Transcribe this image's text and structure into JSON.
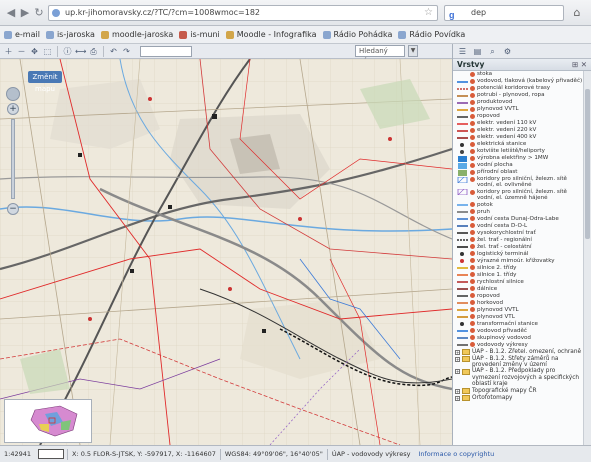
{
  "browser": {
    "url": "up.kr-jihomoravsky.cz/?TC/?cm=1008wmoc=182",
    "search_value": "dep",
    "search_engine_glyph": "g"
  },
  "bookmarks": [
    {
      "label": "e-mail",
      "fav": "b"
    },
    {
      "label": "is-jaroska",
      "fav": "b"
    },
    {
      "label": "moodle-jaroska",
      "fav": "g"
    },
    {
      "label": "is-muni",
      "fav": "r"
    },
    {
      "label": "Moodle - Infografika",
      "fav": "g"
    },
    {
      "label": "Rádio Pohádka",
      "fav": "b"
    },
    {
      "label": "Rádio Povídka",
      "fav": "b"
    }
  ],
  "toolbar": {
    "find_placeholder": "Hledaný výraz...",
    "icons": [
      "zoom-in-icon",
      "zoom-out-icon",
      "pan-icon",
      "zoom-box-icon",
      "info-icon",
      "measure-icon",
      "print-icon",
      "back-icon",
      "forward-icon"
    ]
  },
  "map": {
    "tab_label": "Změnit mapu"
  },
  "panel": {
    "title": "Vrstvy",
    "controls": "⊞ ✕"
  },
  "layers": [
    {
      "type": "layer",
      "label": "stoka",
      "sym": "none",
      "color": "#555"
    },
    {
      "type": "layer",
      "label": "vodovod, tlaková (kabelový přivaděč)",
      "sym": "line",
      "color": "#1b6fd6"
    },
    {
      "type": "layer",
      "label": "potenciál koridorové trasy",
      "sym": "dash",
      "color": "#c2423a"
    },
    {
      "type": "layer",
      "label": "potrubí - plynovod, ropa",
      "sym": "line",
      "color": "#b36b1e"
    },
    {
      "type": "layer",
      "label": "produktovod",
      "sym": "line",
      "color": "#7a3b9c"
    },
    {
      "type": "layer",
      "label": "plynovod VVTL",
      "sym": "line",
      "color": "#d48b00"
    },
    {
      "type": "layer",
      "label": "ropovod",
      "sym": "line",
      "color": "#333"
    },
    {
      "type": "layer",
      "label": "elektr. vedení 110 kV",
      "sym": "line",
      "color": "#e02b2b"
    },
    {
      "type": "layer",
      "label": "elektr. vedení 220 kV",
      "sym": "line",
      "color": "#c01d1d"
    },
    {
      "type": "layer",
      "label": "elektr. vedení 400 kV",
      "sym": "line",
      "color": "#8e1010"
    },
    {
      "type": "layer",
      "label": "elektrická stanice",
      "sym": "dot",
      "color": "#333"
    },
    {
      "type": "layer",
      "label": "kotvište letiště/heliporty",
      "sym": "dot",
      "color": "#444"
    },
    {
      "type": "layer",
      "label": "výrobna elektřiny > 1MW",
      "sym": "box",
      "color": "#2a7fd0"
    },
    {
      "type": "layer",
      "label": "vodní plocha",
      "sym": "box",
      "color": "#5aa9e6"
    },
    {
      "type": "layer",
      "label": "přírodní oblast",
      "sym": "box",
      "color": "#88b06a"
    },
    {
      "type": "layer",
      "label": "koridory pro silniční, železn. sítě vodní, el. ovlivněné",
      "sym": "hatch",
      "color": "#3d7bd8"
    },
    {
      "type": "layer",
      "label": "koridory pro silniční, železn. sítě vodní, el. územně hájené",
      "sym": "hatch",
      "color": "#8f5cc4"
    },
    {
      "type": "layer",
      "label": "potok",
      "sym": "line",
      "color": "#4c9be6"
    },
    {
      "type": "layer",
      "label": "pruh",
      "sym": "line",
      "color": "#666"
    },
    {
      "type": "layer",
      "label": "vodní cesta Dunaj-Odra-Labe",
      "sym": "line",
      "color": "#2d6fc8"
    },
    {
      "type": "layer",
      "label": "vodní cesta D-O-L",
      "sym": "line",
      "color": "#2257a6"
    },
    {
      "type": "layer",
      "label": "vysokorychlostní trať",
      "sym": "line",
      "color": "#222"
    },
    {
      "type": "layer",
      "label": "žel. trať - regionální",
      "sym": "dash",
      "color": "#333"
    },
    {
      "type": "layer",
      "label": "žel. trať - celostátní",
      "sym": "line",
      "color": "#111"
    },
    {
      "type": "layer",
      "label": "logistický terminál",
      "sym": "dot",
      "color": "#333"
    },
    {
      "type": "layer",
      "label": "výrazné mimoúr. křižovatky",
      "sym": "dot",
      "color": "#c33"
    },
    {
      "type": "layer",
      "label": "silnice 2. třídy",
      "sym": "line",
      "color": "#d9a400"
    },
    {
      "type": "layer",
      "label": "silnice 1. třídy",
      "sym": "line",
      "color": "#e25b1e"
    },
    {
      "type": "layer",
      "label": "rychlostní silnice",
      "sym": "line",
      "color": "#b32525"
    },
    {
      "type": "layer",
      "label": "dálnice",
      "sym": "line",
      "color": "#7a1616"
    },
    {
      "type": "layer",
      "label": "ropovod",
      "sym": "line",
      "color": "#333"
    },
    {
      "type": "layer",
      "label": "horkovod",
      "sym": "line",
      "color": "#d9682a"
    },
    {
      "type": "layer",
      "label": "plynovod VVTL",
      "sym": "line",
      "color": "#d48b00"
    },
    {
      "type": "layer",
      "label": "plynovod VTL",
      "sym": "line",
      "color": "#c87c00"
    },
    {
      "type": "layer",
      "label": "transformační stanice",
      "sym": "dot",
      "color": "#333"
    },
    {
      "type": "layer",
      "label": "vodovod přivaděč",
      "sym": "line",
      "color": "#1b6fd6"
    },
    {
      "type": "layer",
      "label": "skupinový vodovod",
      "sym": "line",
      "color": "#2a63b0"
    },
    {
      "type": "layer",
      "label": "vodovody výkresy",
      "sym": "line",
      "color": "#444"
    },
    {
      "type": "group",
      "label": "ÚAP - B.1.2. Zřetel. omezení, ochraně"
    },
    {
      "type": "group",
      "label": "ÚAP - B.1.2. Střety záměrů na provedení změny v území"
    },
    {
      "type": "group",
      "label": "ÚAP - B.1.2. Předpoklady pro vymezení rozvojových a specifických oblastí kraje"
    },
    {
      "type": "group",
      "label": "Topografické mapy ČR"
    },
    {
      "type": "group",
      "label": "Ortofotomapy"
    }
  ],
  "status": {
    "scale": "1:42941",
    "coords_a": "X: 0.5 FLOR-S-JTSK, Y: -597917, X: -1164607",
    "coords_b": "WGS84: 49°09'06\", 16°40'05\"",
    "right_a": "ÚAP - vodovody výkresy",
    "right_b": "Informace o copyrightu"
  }
}
